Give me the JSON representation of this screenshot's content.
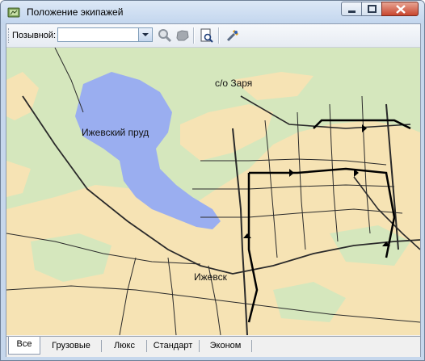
{
  "window": {
    "title": "Положение экипажей"
  },
  "toolbar": {
    "callsign_label": "Позывной:",
    "callsign_value": "",
    "buttons": [
      {
        "icon": "search-zoom-icon"
      },
      {
        "icon": "locate-icon"
      },
      {
        "icon": "print-preview-icon"
      },
      {
        "icon": "settings-tool-icon"
      }
    ]
  },
  "map": {
    "labels": {
      "pond": "Ижевский пруд",
      "zarya": "с/о Заря",
      "izhevsk": "Ижевск"
    },
    "colors": {
      "forest": "#d5e7bd",
      "urban": "#f6e3b4",
      "water": "#9aaef0",
      "roads": "#2a2a2a"
    }
  },
  "tabs": [
    {
      "label": "Все",
      "active": true
    },
    {
      "label": "Грузовые",
      "active": false
    },
    {
      "label": "Люкс",
      "active": false
    },
    {
      "label": "Стандарт",
      "active": false
    },
    {
      "label": "Эконом",
      "active": false
    }
  ]
}
